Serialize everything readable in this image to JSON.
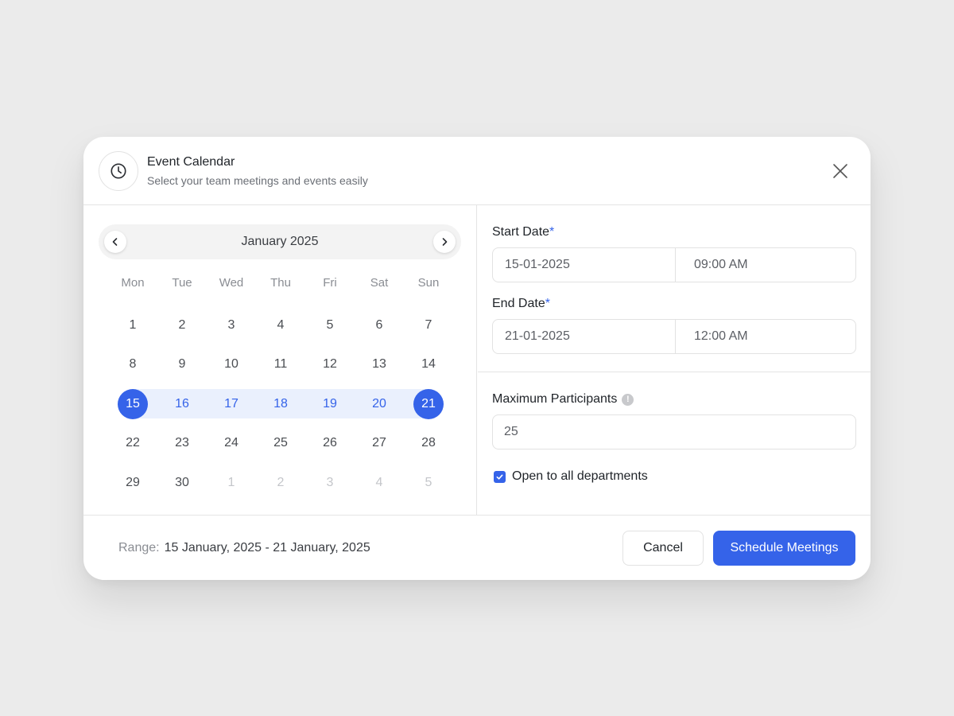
{
  "header": {
    "title": "Event Calendar",
    "subtitle": "Select your team meetings and events easily",
    "icon": "clock-icon",
    "close_icon": "close-icon"
  },
  "calendar": {
    "month_label": "January 2025",
    "prev_icon": "chevron-left-icon",
    "next_icon": "chevron-right-icon",
    "weekdays": [
      "Mon",
      "Tue",
      "Wed",
      "Thu",
      "Fri",
      "Sat",
      "Sun"
    ],
    "days": [
      {
        "label": "1",
        "state": "normal"
      },
      {
        "label": "2",
        "state": "normal"
      },
      {
        "label": "3",
        "state": "normal"
      },
      {
        "label": "4",
        "state": "normal"
      },
      {
        "label": "5",
        "state": "normal"
      },
      {
        "label": "6",
        "state": "normal"
      },
      {
        "label": "7",
        "state": "normal"
      },
      {
        "label": "8",
        "state": "normal"
      },
      {
        "label": "9",
        "state": "normal"
      },
      {
        "label": "10",
        "state": "normal"
      },
      {
        "label": "11",
        "state": "normal"
      },
      {
        "label": "12",
        "state": "normal"
      },
      {
        "label": "13",
        "state": "normal"
      },
      {
        "label": "14",
        "state": "normal"
      },
      {
        "label": "15",
        "state": "selected"
      },
      {
        "label": "16",
        "state": "in-range"
      },
      {
        "label": "17",
        "state": "in-range"
      },
      {
        "label": "18",
        "state": "in-range"
      },
      {
        "label": "19",
        "state": "in-range"
      },
      {
        "label": "20",
        "state": "in-range"
      },
      {
        "label": "21",
        "state": "selected"
      },
      {
        "label": "22",
        "state": "normal"
      },
      {
        "label": "23",
        "state": "normal"
      },
      {
        "label": "24",
        "state": "normal"
      },
      {
        "label": "25",
        "state": "normal"
      },
      {
        "label": "26",
        "state": "normal"
      },
      {
        "label": "27",
        "state": "normal"
      },
      {
        "label": "28",
        "state": "normal"
      },
      {
        "label": "29",
        "state": "normal"
      },
      {
        "label": "30",
        "state": "normal"
      },
      {
        "label": "1",
        "state": "muted"
      },
      {
        "label": "2",
        "state": "muted"
      },
      {
        "label": "3",
        "state": "muted"
      },
      {
        "label": "4",
        "state": "muted"
      },
      {
        "label": "5",
        "state": "muted"
      }
    ]
  },
  "form": {
    "start_date": {
      "label": "Start Date",
      "required_mark": "*",
      "date": "15-01-2025",
      "time": "09:00 AM"
    },
    "end_date": {
      "label": "End Date",
      "required_mark": "*",
      "date": "21-01-2025",
      "time": "12:00 AM"
    },
    "max_participants": {
      "label": "Maximum Participants",
      "value": "25",
      "info_icon": "info-icon",
      "info_glyph": "!"
    },
    "open_departments": {
      "label": "Open to all departments",
      "checked": true,
      "check_icon": "check-icon"
    }
  },
  "footer": {
    "range_prefix": "Range:",
    "range_value": "15 January, 2025 - 21 January, 2025",
    "cancel_label": "Cancel",
    "submit_label": "Schedule Meetings"
  },
  "colors": {
    "accent": "#3563e9",
    "range_band": "#eaf0fd",
    "background": "#ebebeb"
  }
}
